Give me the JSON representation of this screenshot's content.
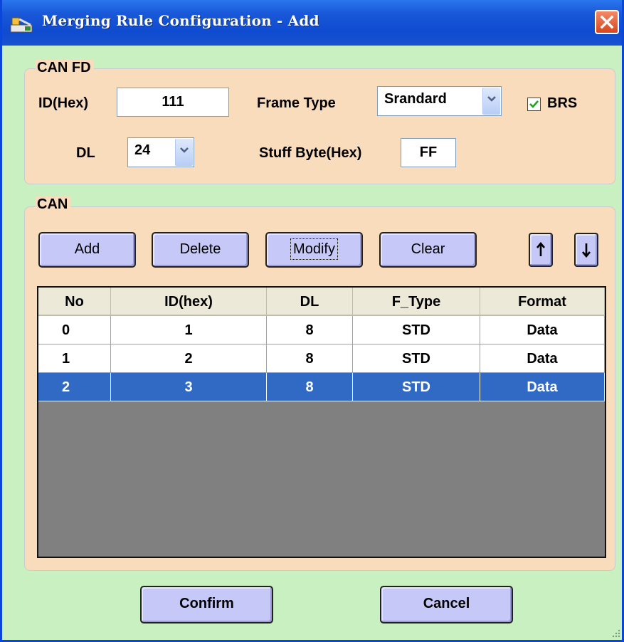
{
  "window": {
    "title": "Merging Rule Configuration - Add"
  },
  "canfd": {
    "group_label": "CAN FD",
    "id_label": "ID(Hex)",
    "id_value": "111",
    "frame_type_label": "Frame Type",
    "frame_type_value": "Srandard",
    "brs_label": "BRS",
    "brs_checked": true,
    "dl_label": "DL",
    "dl_value": "24",
    "stuff_label": "Stuff Byte(Hex)",
    "stuff_value": "FF"
  },
  "can": {
    "group_label": "CAN",
    "buttons": {
      "add": "Add",
      "delete": "Delete",
      "modify": "Modify",
      "clear": "Clear"
    },
    "table": {
      "columns": [
        "No",
        "ID(hex)",
        "DL",
        "F_Type",
        "Format"
      ],
      "rows": [
        {
          "no": "0",
          "id": "1",
          "dl": "8",
          "ftype": "STD",
          "format": "Data"
        },
        {
          "no": "1",
          "id": "2",
          "dl": "8",
          "ftype": "STD",
          "format": "Data"
        },
        {
          "no": "2",
          "id": "3",
          "dl": "8",
          "ftype": "STD",
          "format": "Data"
        }
      ],
      "selected_row": 2
    }
  },
  "footer": {
    "confirm": "Confirm",
    "cancel": "Cancel"
  },
  "colors": {
    "titlebar": "#0f4bd0",
    "client": "#c8f0c0",
    "group": "#f9dcbc",
    "button": "#c6c8f8",
    "selection": "#316ac5"
  }
}
